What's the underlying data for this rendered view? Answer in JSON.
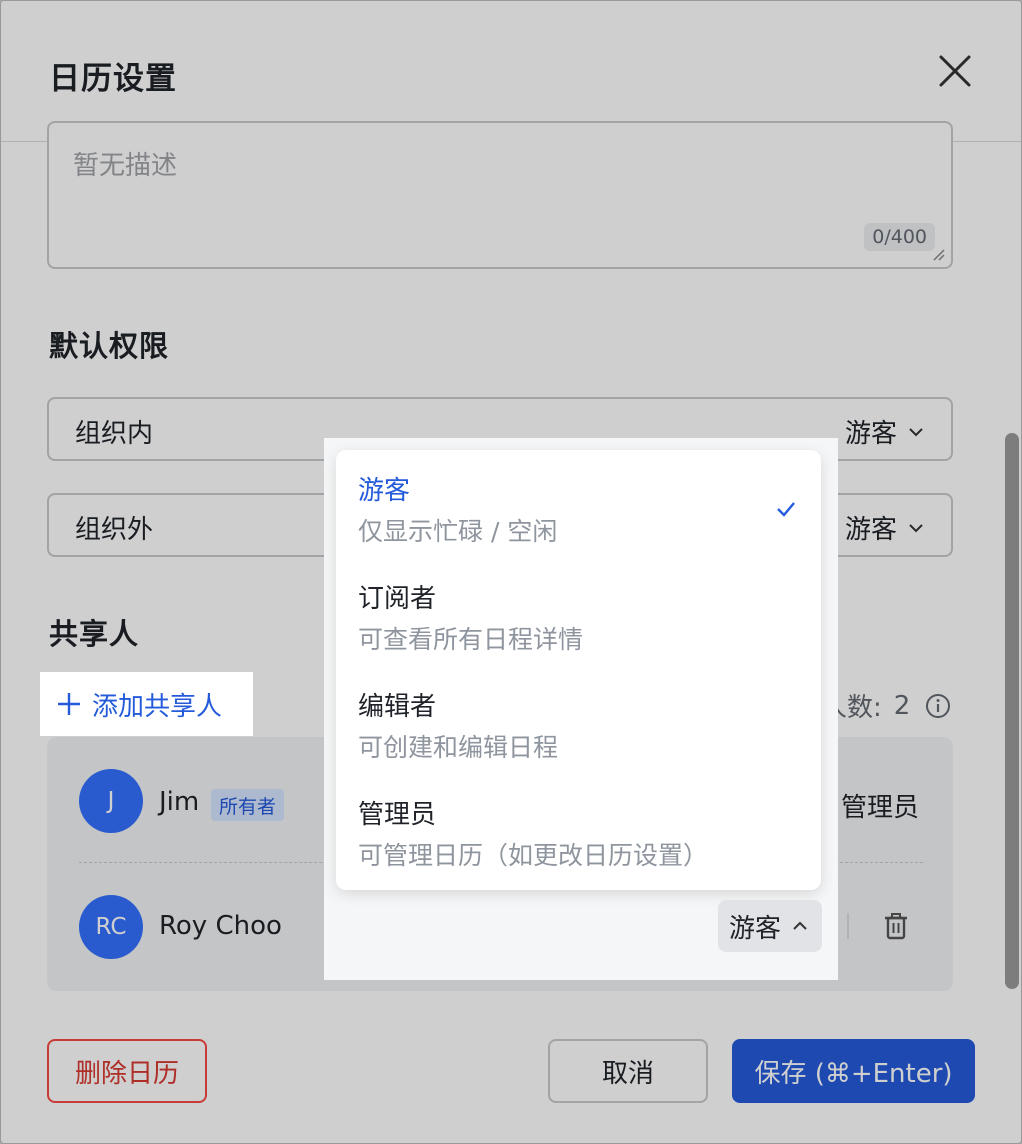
{
  "dialog": {
    "title": "日历设置"
  },
  "description": {
    "placeholder": "暂无描述",
    "counter": "0/400"
  },
  "default_permissions": {
    "title": "默认权限",
    "rows": [
      {
        "label": "组织内",
        "value": "游客"
      },
      {
        "label": "组织外",
        "value": "游客"
      }
    ]
  },
  "sharers": {
    "title": "共享人",
    "add_label": "添加共享人",
    "count_label": "人数:",
    "count_value": "2",
    "list": [
      {
        "initials": "J",
        "name": "Jim",
        "badge": "所有者",
        "role": "管理员"
      },
      {
        "initials": "RC",
        "name": "Roy Choo",
        "role": "游客"
      }
    ]
  },
  "dropdown": {
    "options": [
      {
        "label": "游客",
        "desc": "仅显示忙碌 / 空闲",
        "selected": true
      },
      {
        "label": "订阅者",
        "desc": "可查看所有日程详情",
        "selected": false
      },
      {
        "label": "编辑者",
        "desc": "可创建和编辑日程",
        "selected": false
      },
      {
        "label": "管理员",
        "desc": "可管理日历（如更改日历设置）",
        "selected": false
      }
    ]
  },
  "footer": {
    "delete_label": "删除日历",
    "cancel_label": "取消",
    "save_label": "保存 (⌘+Enter)"
  },
  "colors": {
    "accent": "#245bdb",
    "danger": "#d83931",
    "badge_bg": "#d6e4ff",
    "avatar": "#3370ff"
  }
}
